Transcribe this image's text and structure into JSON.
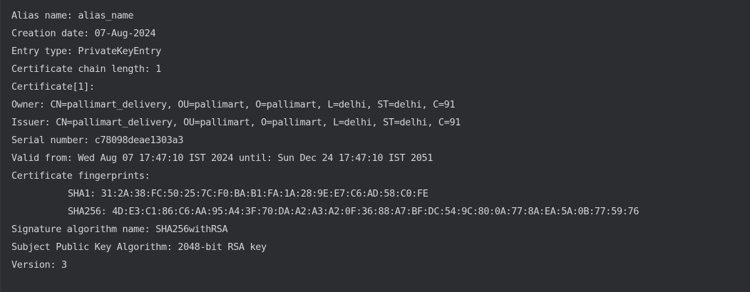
{
  "terminal": {
    "lines": [
      "Alias name: alias_name",
      "Creation date: 07-Aug-2024",
      "Entry type: PrivateKeyEntry",
      "Certificate chain length: 1",
      "Certificate[1]:",
      "Owner: CN=pallimart_delivery, OU=pallimart, O=pallimart, L=delhi, ST=delhi, C=91",
      "Issuer: CN=pallimart_delivery, OU=pallimart, O=pallimart, L=delhi, ST=delhi, C=91",
      "Serial number: c78098deae1303a3",
      "Valid from: Wed Aug 07 17:47:10 IST 2024 until: Sun Dec 24 17:47:10 IST 2051",
      "Certificate fingerprints:",
      "SHA1: 31:2A:38:FC:50:25:7C:F0:BA:B1:FA:1A:28:9E:E7:C6:AD:58:C0:FE",
      "SHA256: 4D:E3:C1:86:C6:AA:95:A4:3F:70:DA:A2:A3:A2:0F:36:88:A7:BF:DC:54:9C:80:0A:77:8A:EA:5A:0B:77:59:76",
      "Signature algorithm name: SHA256withRSA",
      "Subject Public Key Algorithm: 2048-bit RSA key",
      "Version: 3"
    ]
  },
  "colors": {
    "background": "#2b2d30",
    "text": "#d2d4d8"
  }
}
